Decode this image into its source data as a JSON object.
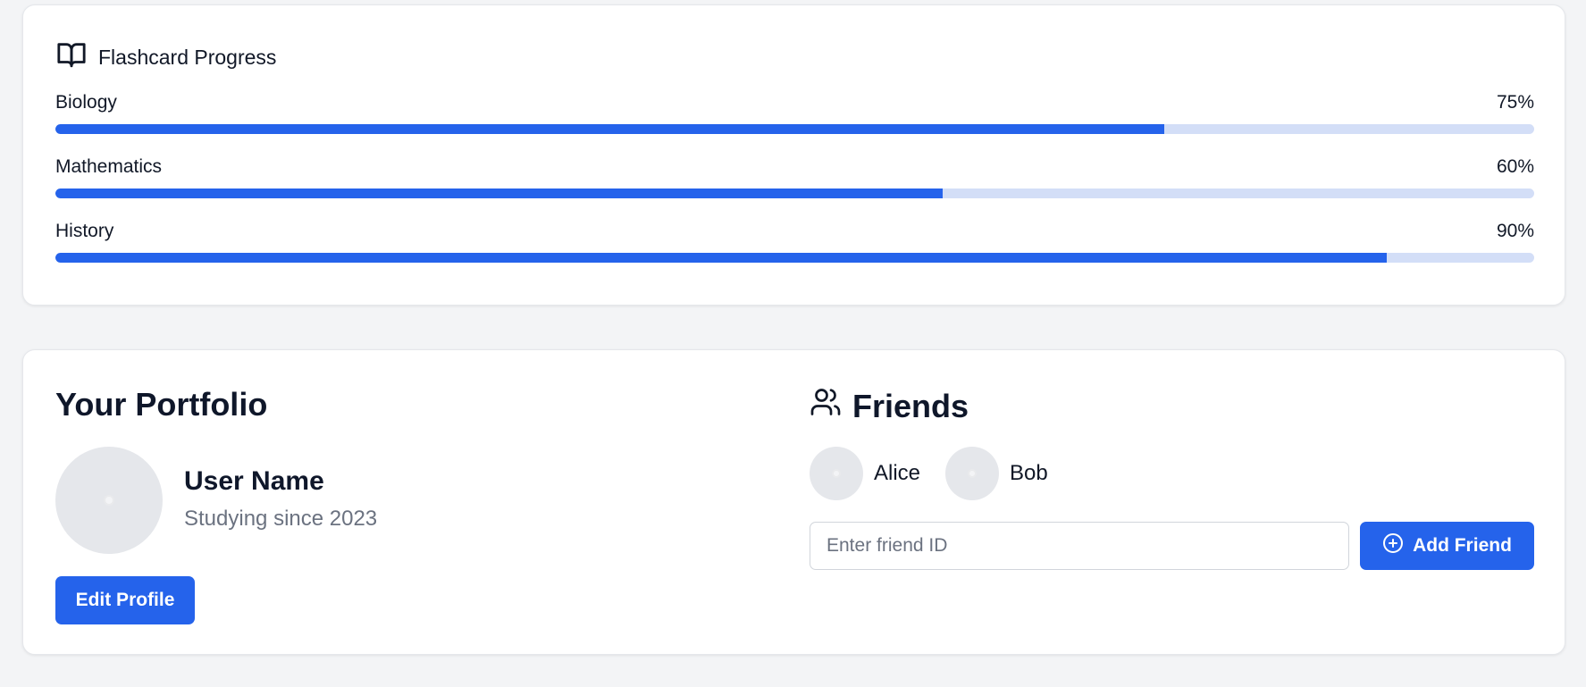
{
  "progress": {
    "title": "Flashcard Progress",
    "icon": "book-open-icon",
    "subjects": [
      {
        "name": "Biology",
        "percent_label": "75%",
        "percent": 75
      },
      {
        "name": "Mathematics",
        "percent_label": "60%",
        "percent": 60
      },
      {
        "name": "History",
        "percent_label": "90%",
        "percent": 90
      }
    ]
  },
  "portfolio": {
    "title": "Your Portfolio",
    "user_name": "User Name",
    "since": "Studying since 2023",
    "edit_button": "Edit Profile"
  },
  "friends": {
    "title": "Friends",
    "icon": "users-icon",
    "list": [
      {
        "name": "Alice"
      },
      {
        "name": "Bob"
      }
    ],
    "input_placeholder": "Enter friend ID",
    "input_value": "",
    "add_button": "Add Friend",
    "add_icon": "plus-circle-icon"
  },
  "colors": {
    "accent": "#2563eb",
    "track": "#d3def7",
    "background": "#f3f4f6"
  }
}
